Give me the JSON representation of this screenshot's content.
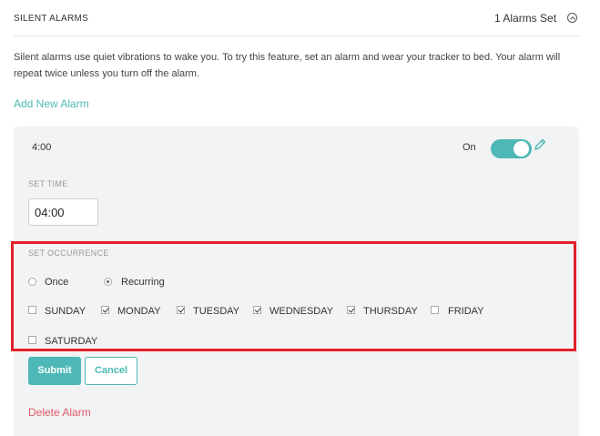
{
  "header": {
    "title": "SILENT ALARMS",
    "alarms_set": "1 Alarms Set",
    "collapse_icon": "chevron-up-circle-icon"
  },
  "description": "Silent alarms use quiet vibrations to wake you. To try this feature, set an alarm and wear your tracker to bed. Your alarm will repeat twice unless you turn off the alarm.",
  "add_alarm_label": "Add New Alarm",
  "alarm": {
    "time_display": "4:00",
    "toggle_label": "On",
    "toggle_on": true,
    "edit_icon": "pencil-icon",
    "set_time_label": "SET TIME",
    "time_value": "04:00",
    "set_occurrence_label": "SET OCCURRENCE",
    "occurrence_options": [
      {
        "label": "Once",
        "selected": false
      },
      {
        "label": "Recurring",
        "selected": true
      }
    ],
    "days": [
      {
        "label": "SUNDAY",
        "checked": false
      },
      {
        "label": "MONDAY",
        "checked": true
      },
      {
        "label": "TUESDAY",
        "checked": true
      },
      {
        "label": "WEDNESDAY",
        "checked": true
      },
      {
        "label": "THURSDAY",
        "checked": true
      },
      {
        "label": "FRIDAY",
        "checked": false
      },
      {
        "label": "SATURDAY",
        "checked": false
      }
    ],
    "submit_label": "Submit",
    "cancel_label": "Cancel",
    "delete_label": "Delete Alarm"
  },
  "colors": {
    "accent": "#4db8b5",
    "highlight": "#e0202a",
    "delete": "#e05a6a",
    "panel": "#f2f3f5"
  }
}
